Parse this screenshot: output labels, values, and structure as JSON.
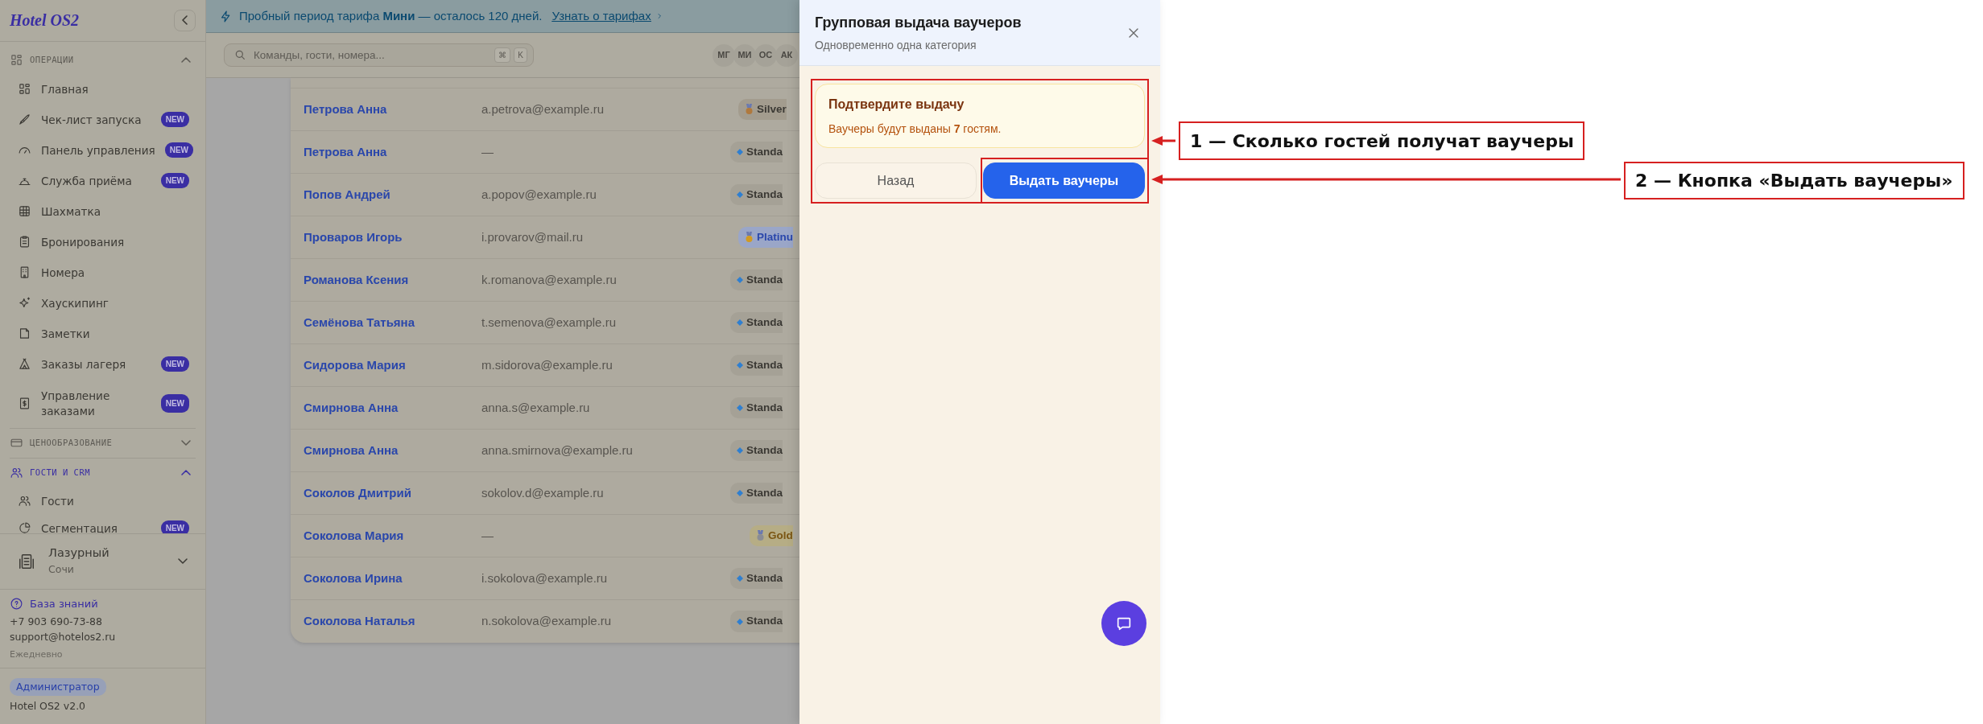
{
  "sidebar": {
    "logo": "Hotel OS2",
    "sections": [
      {
        "title": "ОПЕРАЦИИ",
        "expanded": true,
        "active": false,
        "items": [
          {
            "label": "Главная"
          },
          {
            "label": "Чек-лист запуска",
            "badge": "NEW"
          },
          {
            "label": "Панель управления",
            "badge": "NEW"
          },
          {
            "label": "Служба приёма",
            "badge": "NEW"
          },
          {
            "label": "Шахматка"
          },
          {
            "label": "Бронирования"
          },
          {
            "label": "Номера"
          },
          {
            "label": "Хаускипинг"
          },
          {
            "label": "Заметки"
          },
          {
            "label": "Заказы лагеря",
            "badge": "NEW"
          },
          {
            "label": "Управление заказами",
            "badge": "NEW"
          }
        ]
      },
      {
        "title": "ЦЕНООБРАЗОВАНИЕ",
        "expanded": false,
        "active": false
      },
      {
        "title": "ГОСТИ И CRM",
        "expanded": true,
        "active": true,
        "items": [
          {
            "label": "Гости"
          },
          {
            "label": "Сегментация",
            "badge": "NEW"
          }
        ]
      }
    ],
    "property": {
      "name": "Лазурный",
      "city": "Сочи"
    },
    "support": {
      "link": "База знаний",
      "phone": "+7 903 690-73-88",
      "email": "support@hotelos2.ru",
      "hours": "Ежедневно"
    },
    "role": "Администратор",
    "version": "Hotel OS2 v2.0"
  },
  "banner": {
    "text": "Пробный период тарифа **Мини** — осталось 120 дней.",
    "link": "Узнать о тарифах"
  },
  "search": {
    "placeholder": "Команды, гости, номера...",
    "keys": [
      "⌘",
      "K"
    ]
  },
  "avatars": [
    "МГ",
    "МИ",
    "ОС",
    "АК"
  ],
  "guests": [
    {
      "name": "Петрова Анна",
      "email": "a.petrova@example.ru",
      "tier": {
        "label": "Silver",
        "kind": "silver"
      }
    },
    {
      "name": "Петрова Анна",
      "email": "—",
      "tier": {
        "label": "Standa",
        "kind": "standard"
      }
    },
    {
      "name": "Попов Андрей",
      "email": "a.popov@example.ru",
      "tier": {
        "label": "Standa",
        "kind": "standard"
      }
    },
    {
      "name": "Проваров Игорь",
      "email": "i.provarov@mail.ru",
      "tier": {
        "label": "Platinu",
        "kind": "platinum"
      }
    },
    {
      "name": "Романова Ксения",
      "email": "k.romanova@example.ru",
      "tier": {
        "label": "Standa",
        "kind": "standard"
      }
    },
    {
      "name": "Семёнова Татьяна",
      "email": "t.semenova@example.ru",
      "tier": {
        "label": "Standa",
        "kind": "standard"
      }
    },
    {
      "name": "Сидорова Мария",
      "email": "m.sidorova@example.ru",
      "tier": {
        "label": "Standa",
        "kind": "standard"
      }
    },
    {
      "name": "Смирнова Анна",
      "email": "anna.s@example.ru",
      "tier": {
        "label": "Standa",
        "kind": "standard"
      }
    },
    {
      "name": "Смирнова Анна",
      "email": "anna.smirnova@example.ru",
      "tier": {
        "label": "Standa",
        "kind": "standard"
      }
    },
    {
      "name": "Соколов Дмитрий",
      "email": "sokolov.d@example.ru",
      "tier": {
        "label": "Standa",
        "kind": "standard"
      }
    },
    {
      "name": "Соколова Мария",
      "email": "—",
      "tier": {
        "label": "Gold",
        "kind": "gold"
      }
    },
    {
      "name": "Соколова Ирина",
      "email": "i.sokolova@example.ru",
      "tier": {
        "label": "Standa",
        "kind": "standard"
      }
    },
    {
      "name": "Соколова Наталья",
      "email": "n.sokolova@example.ru",
      "tier": {
        "label": "Standa",
        "kind": "standard"
      }
    }
  ],
  "drawer": {
    "title": "Групповая выдача ваучеров",
    "subtitle": "Одновременно одна категория",
    "alert": {
      "title": "Подтвердите выдачу",
      "text": "Ваучеры будут выданы **7** гостям."
    },
    "buttons": [
      {
        "label": "Назад",
        "kind": "secondary"
      },
      {
        "label": "Выдать ваучеры",
        "kind": "primary"
      }
    ]
  },
  "annotations": [
    {
      "label": "1 — Сколько гостей получат ваучеры"
    },
    {
      "label": "2 — Кнопка «Выдать ваучеры»"
    }
  ]
}
